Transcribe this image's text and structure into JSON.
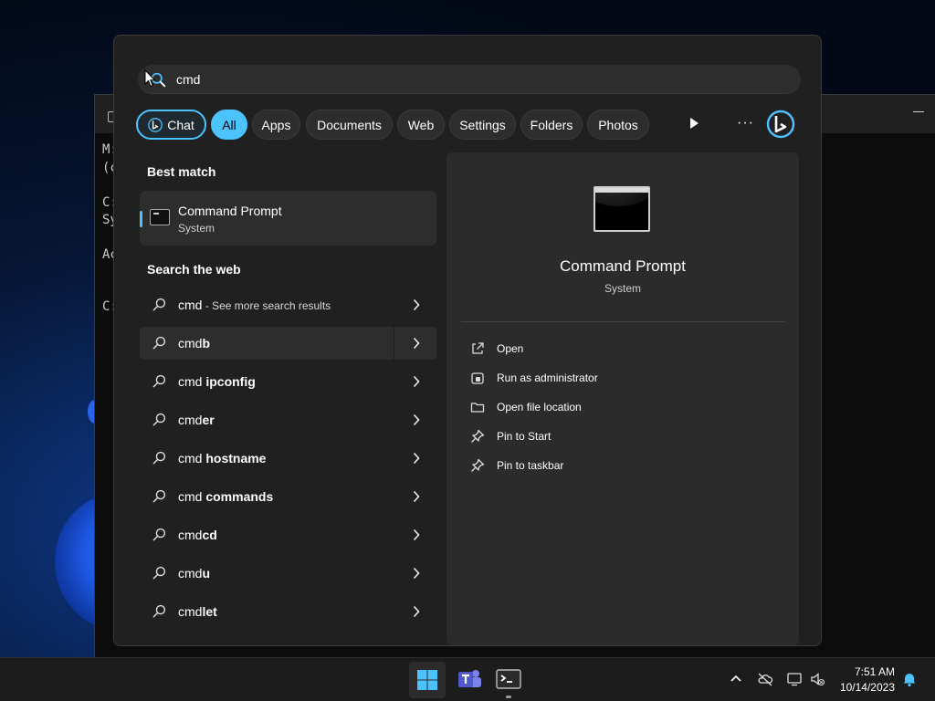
{
  "search": {
    "query": "cmd"
  },
  "filters": {
    "chat": "Chat",
    "items": [
      "All",
      "Apps",
      "Documents",
      "Web",
      "Settings",
      "Folders",
      "Photos"
    ],
    "more": "···"
  },
  "left": {
    "best_match_heading": "Best match",
    "best_match": {
      "title": "Command Prompt",
      "subtitle": "System"
    },
    "web_heading": "Search the web",
    "web_results": [
      {
        "prefix": "cmd",
        "suffix": "",
        "hint": " - See more search results"
      },
      {
        "prefix": "cmd",
        "suffix": "b",
        "hint": ""
      },
      {
        "prefix": "cmd ",
        "suffix": "ipconfig",
        "hint": ""
      },
      {
        "prefix": "cmd",
        "suffix": "er",
        "hint": ""
      },
      {
        "prefix": "cmd ",
        "suffix": "hostname",
        "hint": ""
      },
      {
        "prefix": "cmd ",
        "suffix": "commands",
        "hint": ""
      },
      {
        "prefix": "cmd",
        "suffix": "cd",
        "hint": ""
      },
      {
        "prefix": "cmd",
        "suffix": "u",
        "hint": ""
      },
      {
        "prefix": "cmd",
        "suffix": "let",
        "hint": ""
      }
    ]
  },
  "detail": {
    "title": "Command Prompt",
    "subtitle": "System",
    "actions": [
      "Open",
      "Run as administrator",
      "Open file location",
      "Pin to Start",
      "Pin to taskbar"
    ]
  },
  "terminal": {
    "lines": [
      "M:",
      "(c",
      "C:",
      "Sy",
      "Ac",
      "C:"
    ]
  },
  "taskbar": {
    "time": "7:51 AM",
    "date": "10/14/2023"
  },
  "colors": {
    "accent": "#4cc2ff",
    "flyout_bg": "#202020",
    "panel_bg": "#2b2b2b"
  }
}
